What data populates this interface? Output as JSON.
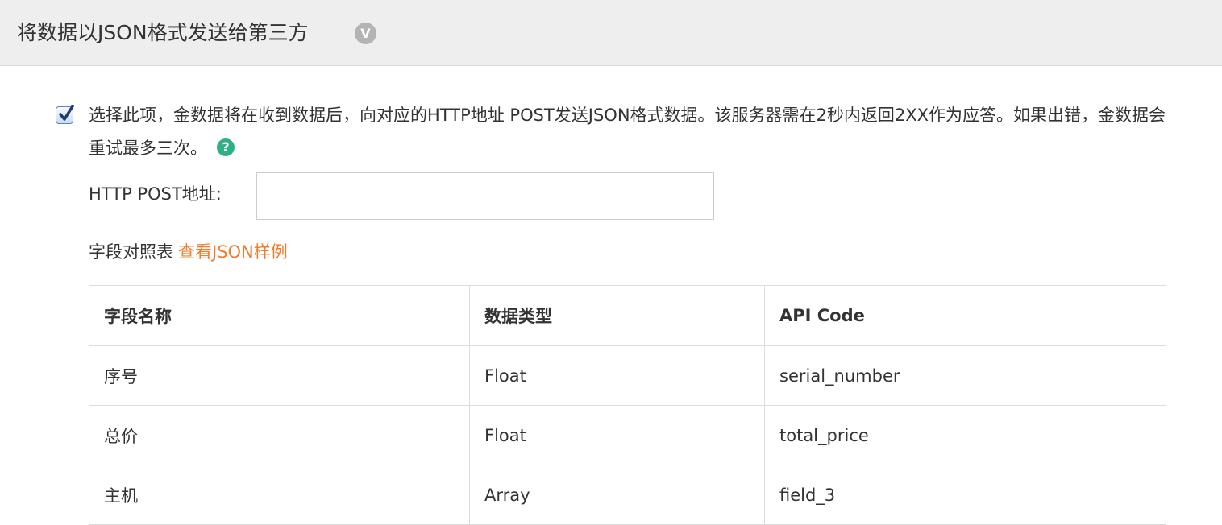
{
  "header": {
    "title": "将数据以JSON格式发送给第三方",
    "badge": "V"
  },
  "option": {
    "checked": true,
    "description": "选择此项，金数据将在收到数据后，向对应的HTTP地址 POST发送JSON格式数据。该服务器需在2秒内返回2XX作为应答。如果出错，金数据会重试最多三次。",
    "help_icon": "?"
  },
  "url_field": {
    "label": "HTTP POST地址:",
    "value": ""
  },
  "mapping": {
    "title": "字段对照表",
    "link": "查看JSON样例"
  },
  "table": {
    "headers": [
      "字段名称",
      "数据类型",
      "API Code"
    ],
    "rows": [
      [
        "序号",
        "Float",
        "serial_number"
      ],
      [
        "总价",
        "Float",
        "total_price"
      ],
      [
        "主机",
        "Array",
        "field_3"
      ]
    ]
  },
  "colors": {
    "header_bg": "#eeeeee",
    "link": "#f07c2e",
    "help": "#2fb083"
  }
}
